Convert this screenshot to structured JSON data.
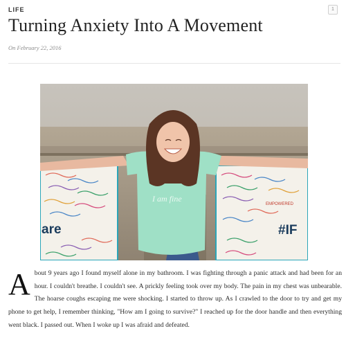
{
  "post": {
    "category": "LIFE",
    "comment_count": "1",
    "title": "Turning Anxiety Into A Movement",
    "date": "On February 22, 2016"
  },
  "photo": {
    "shirt_text": "I am fine",
    "left_poster_text": "are",
    "right_poster_text": "#IF",
    "right_poster_tag": "EMPOWERED",
    "colors": {
      "sky": "#c8c4bd",
      "stone": "#a29684",
      "shirt": "#9fe0c6",
      "hair": "#5b3524",
      "poster_border": "#2aa5b8",
      "poster_text": "#1a3b5c"
    }
  },
  "article": {
    "dropcap": "A",
    "body": "bout 9 years ago I found myself alone in my bathroom. I was fighting through a panic attack and had been for an hour. I couldn't breathe. I couldn't see. A prickly feeling took over my body. The pain in my chest was unbearable. The hoarse coughs escaping me were shocking. I started to throw up. As I crawled to the door to try and get my phone to get help, I remember thinking, \"How am I going to survive?\" I reached up for the door handle and then everything went black. I passed out. When I woke up I was afraid and defeated."
  }
}
